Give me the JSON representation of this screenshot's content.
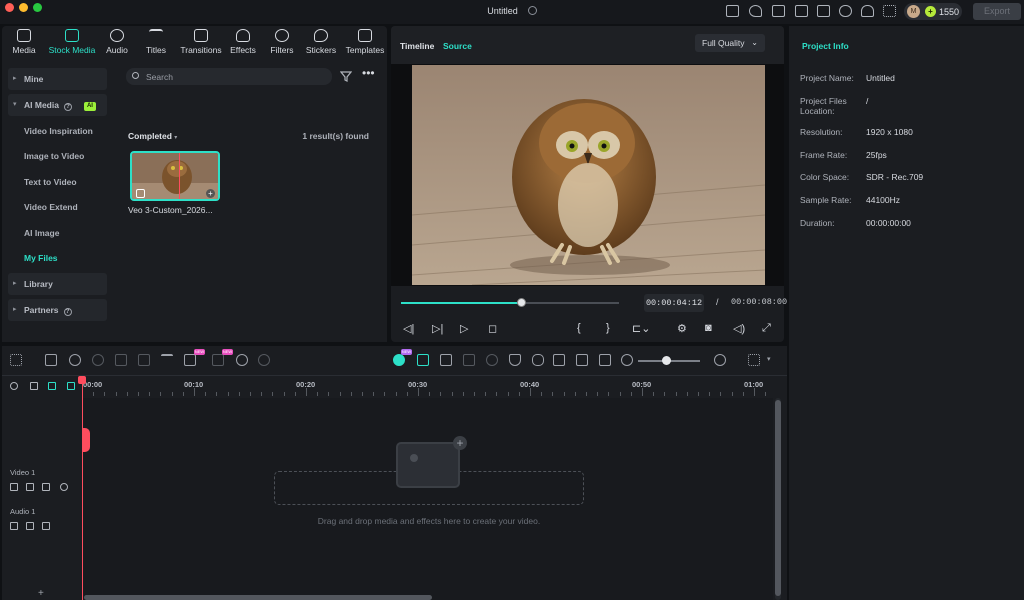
{
  "window": {
    "title": "Untitled",
    "credits": "1550",
    "avatar_letter": "M",
    "export_label": "Export"
  },
  "media_tabs": [
    {
      "label": "Media",
      "icon": "media-icon"
    },
    {
      "label": "Stock Media",
      "icon": "stock-media-icon"
    },
    {
      "label": "Audio",
      "icon": "music-note-icon"
    },
    {
      "label": "Titles",
      "icon": "text-t-icon"
    },
    {
      "label": "Transitions",
      "icon": "transition-icon"
    },
    {
      "label": "Effects",
      "icon": "effects-icon"
    },
    {
      "label": "Filters",
      "icon": "filters-icon"
    },
    {
      "label": "Stickers",
      "icon": "sticker-icon"
    },
    {
      "label": "Templates",
      "icon": "templates-icon"
    }
  ],
  "sidebar": {
    "mine": "Mine",
    "ai_media": "AI Media",
    "ai_badge": "AI",
    "items": [
      "Video Inspiration",
      "Image to Video",
      "Text to Video",
      "Video Extend",
      "AI Image",
      "My Files"
    ],
    "library": "Library",
    "partners": "Partners"
  },
  "media_list": {
    "search_placeholder": "Search",
    "filter_label": "Completed",
    "results": "1 result(s) found",
    "item_name": "Veo 3-Custom_2026..."
  },
  "player": {
    "tab_timeline": "Timeline",
    "tab_source": "Source",
    "quality": "Full Quality",
    "current_time": "00:00:04:12",
    "separator": "/",
    "total_time": "00:00:08:00",
    "progress": 0.5525
  },
  "project_info": {
    "title": "Project Info",
    "rows": [
      {
        "key": "Project Name:",
        "value": "Untitled"
      },
      {
        "key": "Project Files Location:",
        "value": "/"
      },
      {
        "key": "Resolution:",
        "value": "1920 x 1080"
      },
      {
        "key": "Frame Rate:",
        "value": "25fps"
      },
      {
        "key": "Color Space:",
        "value": "SDR - Rec.709"
      },
      {
        "key": "Sample Rate:",
        "value": "44100Hz"
      },
      {
        "key": "Duration:",
        "value": "00:00:00:00"
      }
    ]
  },
  "timeline": {
    "ruler_labels": [
      "00:00",
      "00:10",
      "00:20",
      "00:30",
      "00:40",
      "00:50",
      "01:00"
    ],
    "video_track": "Video 1",
    "audio_track": "Audio 1",
    "drop_hint": "Drag and drop media and effects here to create your video.",
    "new_badge": "NEW",
    "zoom_level": 0.45
  },
  "colors": {
    "accent": "#2de0c8",
    "playhead": "#ff4d5e",
    "ai_badge": "#9cf03a"
  }
}
